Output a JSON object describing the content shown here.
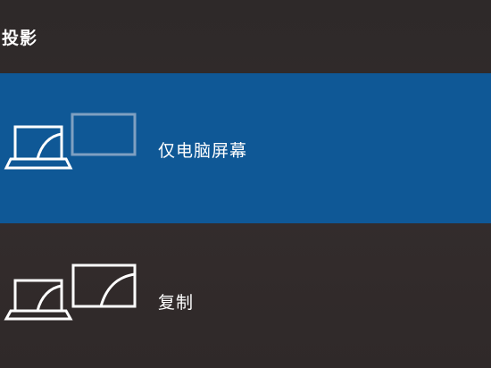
{
  "panel": {
    "title": "投影"
  },
  "options": [
    {
      "label": "仅电脑屏幕",
      "icon": "pc-screen-only-icon",
      "selected": true
    },
    {
      "label": "复制",
      "icon": "duplicate-icon",
      "selected": false
    }
  ],
  "colors": {
    "background": "#2f2a2a",
    "selected": "#0f5896",
    "text": "#ffffff",
    "dimmed_monitor": "#9bb3cc"
  }
}
